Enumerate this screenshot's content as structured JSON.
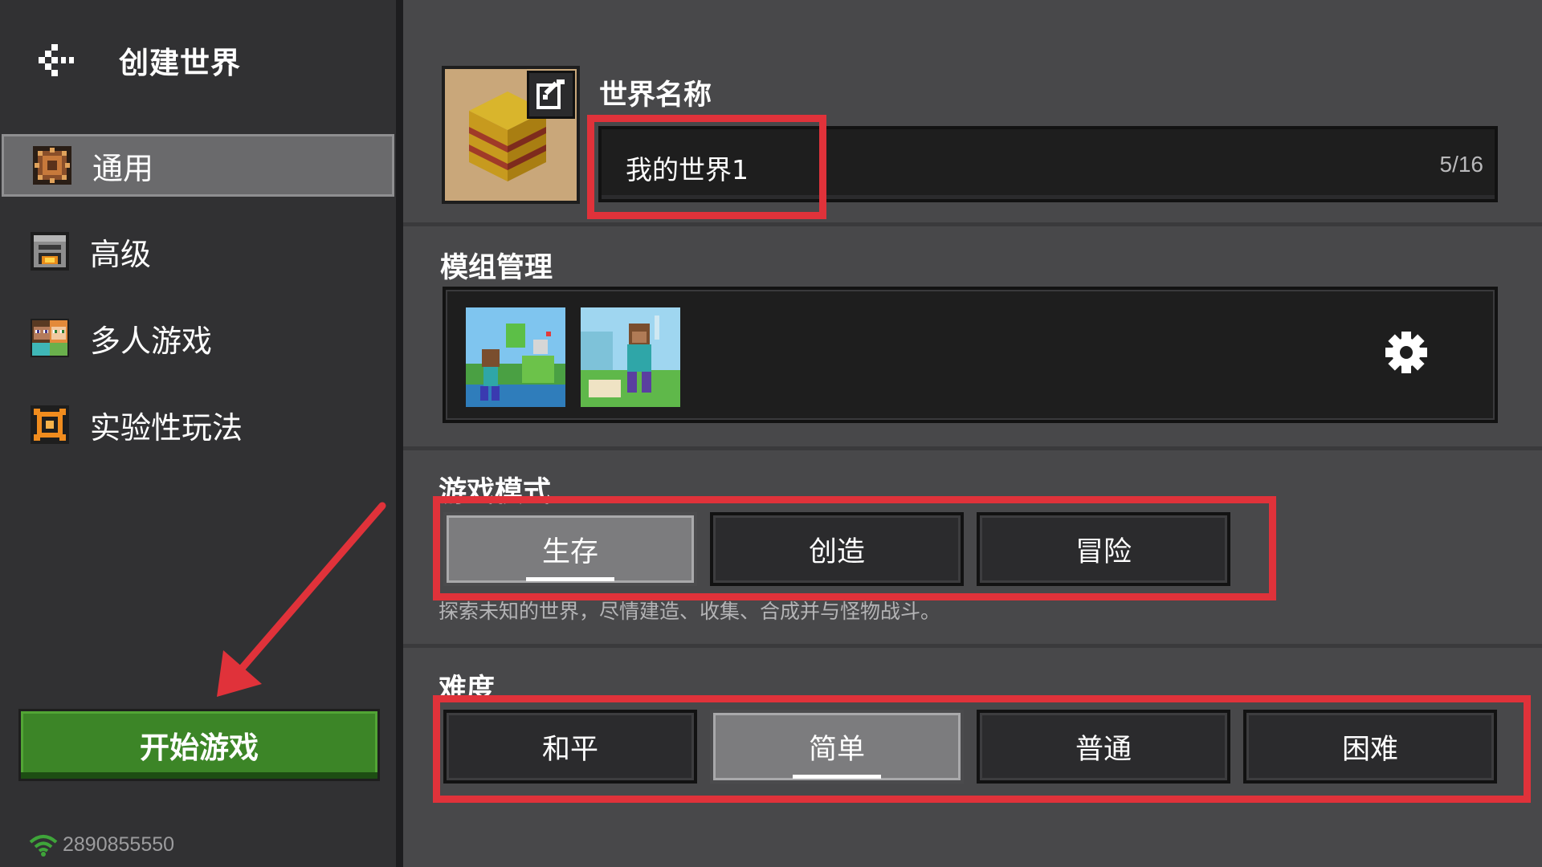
{
  "header": {
    "title": "创建世界",
    "back_icon": "back-arrow-icon"
  },
  "sidebar": {
    "items": [
      {
        "label": "通用",
        "icon": "general-settings-icon",
        "active": true
      },
      {
        "label": "高级",
        "icon": "furnace-icon",
        "active": false
      },
      {
        "label": "多人游戏",
        "icon": "players-icon",
        "active": false
      },
      {
        "label": "实验性玩法",
        "icon": "experiments-icon",
        "active": false
      }
    ],
    "start_label": "开始游戏",
    "footer_id": "2890855550"
  },
  "world": {
    "name_label": "世界名称",
    "name_value": "我的世界1",
    "name_count": "5/16"
  },
  "packs": {
    "label": "模组管理",
    "items": [
      "pack-thumbnail-1",
      "pack-thumbnail-2"
    ]
  },
  "game_mode": {
    "label": "游戏模式",
    "options": [
      "生存",
      "创造",
      "冒险"
    ],
    "selected": "生存",
    "description": "探索未知的世界，尽情建造、收集、合成并与怪物战斗。"
  },
  "difficulty": {
    "label": "难度",
    "options": [
      "和平",
      "简单",
      "普通",
      "困难"
    ],
    "selected": "简单"
  },
  "colors": {
    "accent_green": "#3c8527",
    "annotation_red": "#e0323a",
    "panel_bg": "#48484a",
    "sidebar_bg": "#313133"
  }
}
